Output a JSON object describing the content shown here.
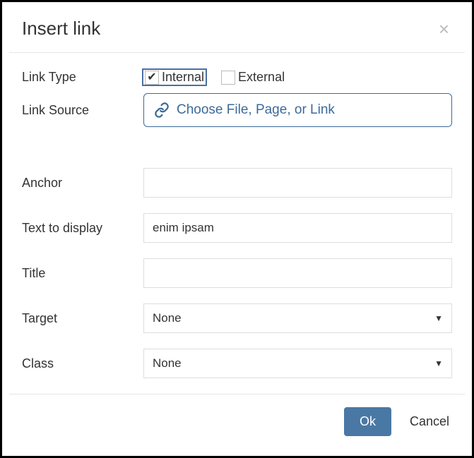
{
  "dialog": {
    "title": "Insert link",
    "close_symbol": "×"
  },
  "fields": {
    "link_type": {
      "label": "Link Type",
      "options": {
        "internal": {
          "label": "Internal",
          "checked": true
        },
        "external": {
          "label": "External",
          "checked": false
        }
      }
    },
    "link_source": {
      "label": "Link Source",
      "button_text": "Choose File, Page, or Link"
    },
    "anchor": {
      "label": "Anchor",
      "value": ""
    },
    "text_to_display": {
      "label": "Text to display",
      "value": "enim ipsam"
    },
    "title": {
      "label": "Title",
      "value": ""
    },
    "target": {
      "label": "Target",
      "value": "None"
    },
    "class": {
      "label": "Class",
      "value": "None"
    }
  },
  "footer": {
    "ok": "Ok",
    "cancel": "Cancel"
  },
  "icons": {
    "checkmark": "✔"
  }
}
